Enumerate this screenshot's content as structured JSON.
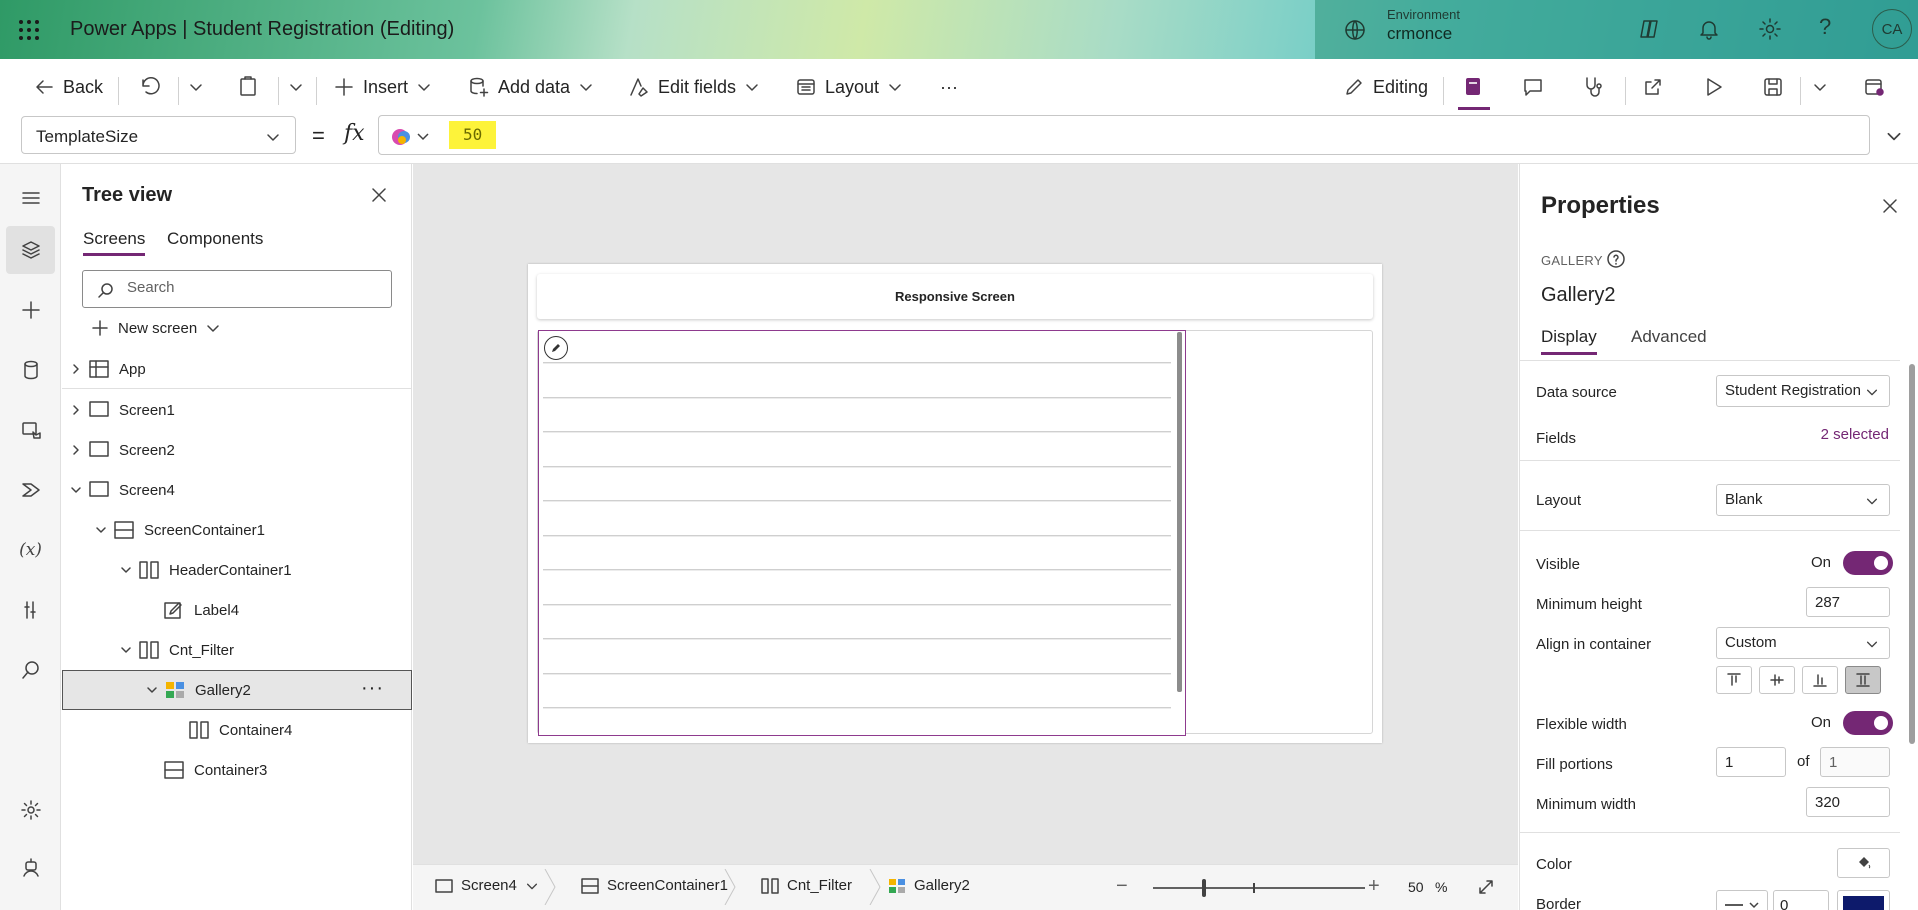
{
  "app": {
    "title": "Power Apps  |  Student Registration (Editing)",
    "environment_label": "Environment",
    "environment_value": "crmonce",
    "avatar_initials": "CA"
  },
  "commandbar": {
    "back": "Back",
    "insert": "Insert",
    "add_data": "Add data",
    "edit_fields": "Edit fields",
    "layout": "Layout",
    "more": "···",
    "editing": "Editing"
  },
  "formula": {
    "property": "TemplateSize",
    "equals": "=",
    "fx": "fx",
    "value": "50"
  },
  "tree": {
    "title": "Tree view",
    "tabs": [
      "Screens",
      "Components"
    ],
    "search_placeholder": "Search",
    "new_screen": "New screen",
    "items": [
      {
        "label": "App"
      },
      {
        "label": "Screen1"
      },
      {
        "label": "Screen2"
      },
      {
        "label": "Screen4"
      },
      {
        "label": "ScreenContainer1"
      },
      {
        "label": "HeaderContainer1"
      },
      {
        "label": "Label4"
      },
      {
        "label": "Cnt_Filter"
      },
      {
        "label": "Gallery2"
      },
      {
        "label": "Container4"
      },
      {
        "label": "Container3"
      }
    ]
  },
  "canvas": {
    "header_text": "Responsive Screen"
  },
  "statusbar": {
    "crumbs": [
      "Screen4",
      "ScreenContainer1",
      "Cnt_Filter",
      "Gallery2"
    ],
    "zoom": "50",
    "zoom_unit": "%",
    "zoom_slider_fraction": 0.23
  },
  "properties": {
    "title": "Properties",
    "control_type": "GALLERY",
    "control_name": "Gallery2",
    "tabs": [
      "Display",
      "Advanced"
    ],
    "data_source_label": "Data source",
    "data_source_value": "Student Registration",
    "fields_label": "Fields",
    "fields_value": "2 selected",
    "layout_label": "Layout",
    "layout_value": "Blank",
    "visible_label": "Visible",
    "visible_value": "On",
    "min_height_label": "Minimum height",
    "min_height_value": "287",
    "align_label": "Align in container",
    "align_value": "Custom",
    "flex_width_label": "Flexible width",
    "flex_width_value": "On",
    "fill_portions_label": "Fill portions",
    "fill_portions_value": "1",
    "of_label": "of",
    "fill_portions_total": "1",
    "min_width_label": "Minimum width",
    "min_width_value": "320",
    "color_label": "Color",
    "border_label": "Border",
    "border_width": "0",
    "border_color": "#0d1a6b"
  },
  "colors": {
    "accent": "#742774",
    "formula_highlight": "#fdf33a"
  }
}
